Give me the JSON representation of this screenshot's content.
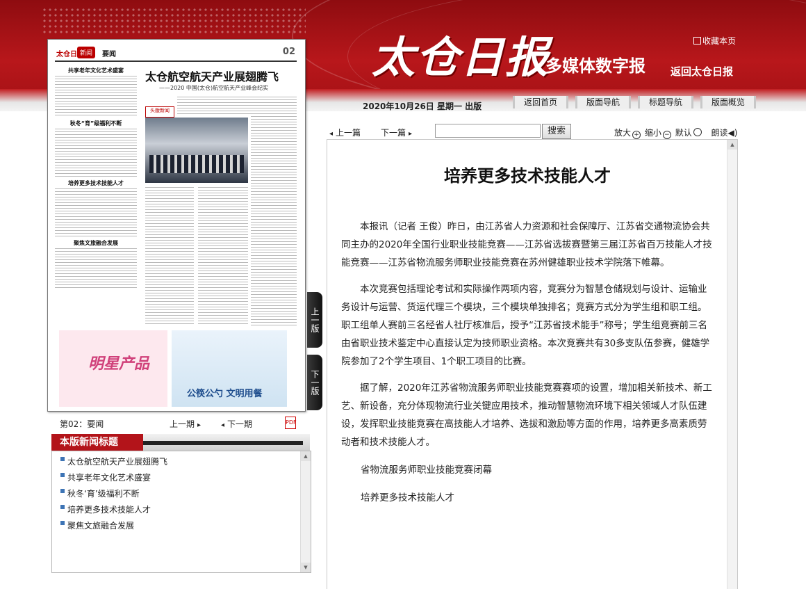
{
  "header": {
    "logo_title": "太仓日报",
    "logo_subtitle": "多媒体数字报",
    "collect": "收藏本页",
    "back_home": "返回太仓日报",
    "date": "2020年10月26日 星期一 出版",
    "nav_tabs": [
      "返回首页",
      "版面导航",
      "标题导航",
      "版面概览"
    ]
  },
  "paper_thumbnail": {
    "brand": "太仓日报",
    "tag": "新闻",
    "section": "要闻",
    "page_number": "02",
    "headline_main": "太仓航空航天产业展翅腾飞",
    "headline_sub": "——2020 中国(太仓)航空航天产业峰会纪实",
    "left_headlines": [
      "共享老年文化艺术盛宴",
      "秋冬“育”级福利不断",
      "培养更多技术技能人才",
      "聚焦文旅融合发展"
    ],
    "logo_box": "头版新闻",
    "ad_left": "明星产品",
    "ad_right": "公筷公勺 文明用餐"
  },
  "side_tabs": {
    "prev": "上一版",
    "next": "下一版"
  },
  "pager": {
    "page_label": "第02：要闻",
    "prev": "上一期",
    "next": "下一期",
    "pdf": "PDF"
  },
  "headline_list": {
    "title": "本版新闻标题",
    "items": [
      "太仓航空航天产业展翅腾飞",
      "共享老年文化艺术盛宴",
      "秋冬‘育’级福利不断",
      "培养更多技术技能人才",
      "聚焦文旅融合发展"
    ]
  },
  "toolbar": {
    "prev": "上一篇",
    "next": "下一篇",
    "search_value": "",
    "search_button": "搜索",
    "zoom_in": "放大",
    "zoom_out": "缩小",
    "default": "默认",
    "read": "朗读"
  },
  "article": {
    "title": "培养更多技术技能人才",
    "paragraphs": [
      "本报讯（记者 王俊）昨日，由江苏省人力资源和社会保障厅、江苏省交通物流协会共同主办的2020年全国行业职业技能竞赛——江苏省选拔赛暨第三届江苏省百万技能人才技能竞赛——江苏省物流服务师职业技能竞赛在苏州健雄职业技术学院落下帷幕。",
      "本次竞赛包括理论考试和实际操作两项内容，竞赛分为智慧仓储规划与设计、运输业务设计与运营、货运代理三个模块，三个模块单独排名；竞赛方式分为学生组和职工组。职工组单人赛前三名经省人社厅核准后，授予“江苏省技术能手”称号；学生组竞赛前三名由省职业技术鉴定中心直接认定为技师职业资格。本次竞赛共有30多支队伍参赛，健雄学院参加了2个学生项目、1个职工项目的比赛。",
      "据了解，2020年江苏省物流服务师职业技能竞赛赛项的设置，增加相关新技术、新工艺、新设备，充分体现物流行业关键应用技术，推动智慧物流环境下相关领域人才队伍建设，发挥职业技能竞赛在高技能人才培养、选拔和激励等方面的作用，培养更多高素质劳动者和技术技能人才。"
    ],
    "captions": [
      "省物流服务师职业技能竞赛闭幕",
      "培养更多技术技能人才"
    ]
  }
}
